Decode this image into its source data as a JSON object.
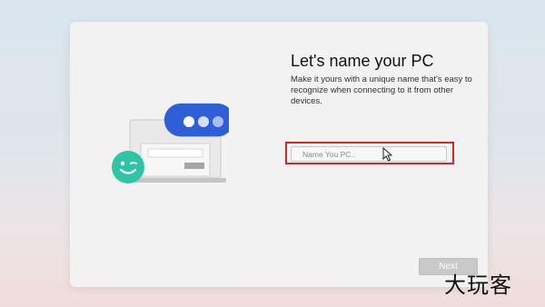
{
  "setup": {
    "title": "Let's name your PC",
    "description": "Make it yours with a unique name that's easy to recognize when connecting to it from other devices.",
    "name_input": {
      "value": "",
      "placeholder": "Name You PC.."
    },
    "next_label": "Next"
  },
  "icons": {
    "illustration": "laptop-with-chat-bubble-illustration",
    "avatar": "winking-face-icon",
    "cursor": "mouse-pointer-icon"
  },
  "watermark": "大玩客",
  "colors": {
    "highlight": "#d4262b",
    "bubble": "#2f5fd6",
    "avatar": "#2ec4a4",
    "button_disabled": "#c9c9c9"
  }
}
